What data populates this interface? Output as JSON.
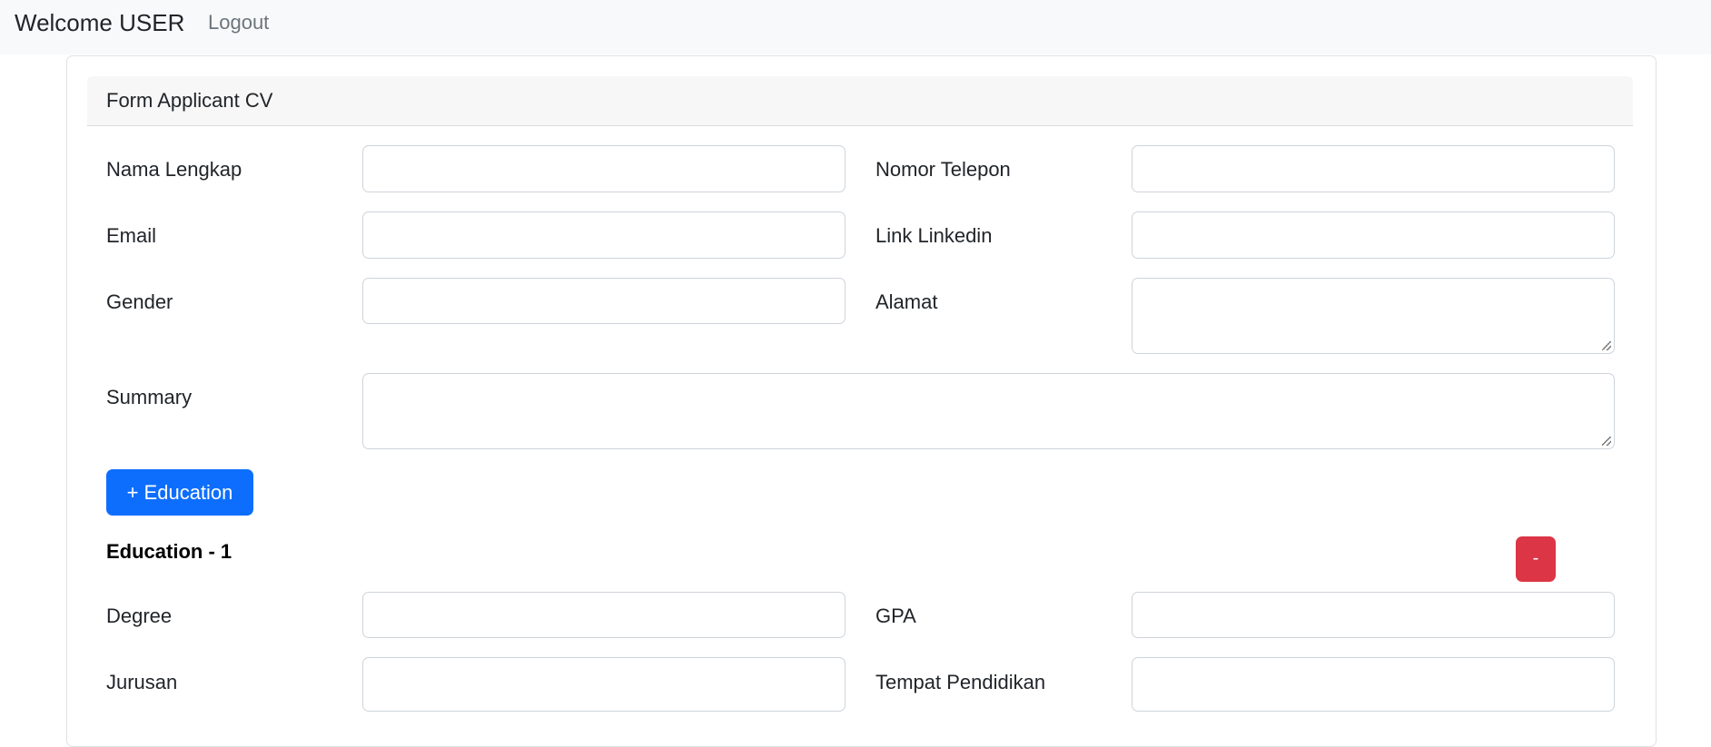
{
  "navbar": {
    "brand": "Welcome USER",
    "logout_label": "Logout"
  },
  "form": {
    "title": "Form Applicant CV",
    "fields": {
      "nama_lengkap": {
        "label": "Nama Lengkap",
        "value": ""
      },
      "nomor_telepon": {
        "label": "Nomor Telepon",
        "value": ""
      },
      "email": {
        "label": "Email",
        "value": ""
      },
      "link_linkedin": {
        "label": "Link Linkedin",
        "value": ""
      },
      "gender": {
        "label": "Gender",
        "value": ""
      },
      "alamat": {
        "label": "Alamat",
        "value": ""
      },
      "summary": {
        "label": "Summary",
        "value": ""
      }
    },
    "add_education_label": "+ Education",
    "education": [
      {
        "title": "Education - 1",
        "remove_label": "-",
        "degree": {
          "label": "Degree",
          "value": ""
        },
        "gpa": {
          "label": "GPA",
          "value": ""
        },
        "jurusan": {
          "label": "Jurusan",
          "value": ""
        },
        "tempat_pendidikan": {
          "label": "Tempat Pendidikan",
          "value": ""
        }
      }
    ]
  },
  "colors": {
    "primary": "#0d6efd",
    "danger": "#dc3545",
    "navbar_bg": "#f8f9fa",
    "card_header_bg": "#f7f7f7"
  }
}
